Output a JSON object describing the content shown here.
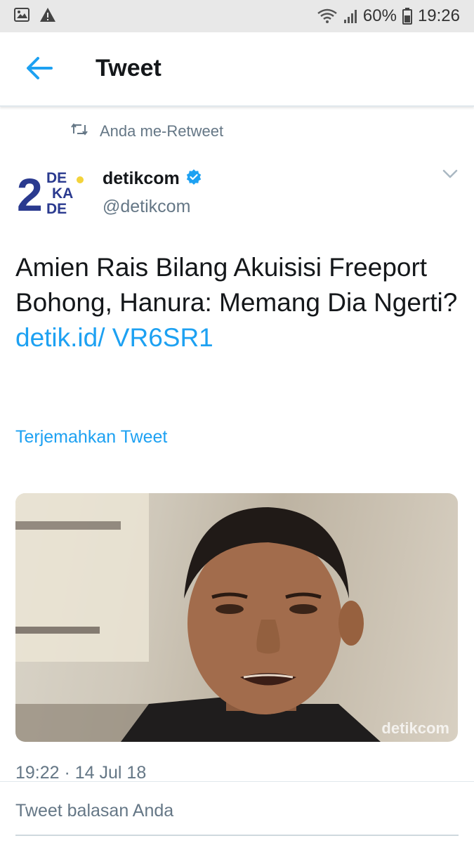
{
  "status_bar": {
    "battery": "60%",
    "time": "19:26",
    "icons": [
      "image-icon",
      "warning-icon",
      "wifi-icon",
      "signal-icon",
      "battery-icon"
    ]
  },
  "app_bar": {
    "title": "Tweet",
    "back_icon": "arrow-left-icon"
  },
  "tweet": {
    "retweet_context": "Anda me-Retweet",
    "avatar_logo": {
      "line1": "DE",
      "line2": "KA",
      "line3": "DE",
      "numeral": "2"
    },
    "display_name": "detikcom",
    "verified": true,
    "handle": "@detikcom",
    "text": "Amien Rais Bilang Akuisisi Freeport Bohong, Hanura: Memang Dia Ngerti?",
    "link_text": "detik.id/ VR6SR1",
    "translate_label": "Terjemahkan Tweet",
    "photo_watermark": "detikcom",
    "timestamp": "19:22 · 14 Jul 18"
  },
  "reply_section": {
    "label": "Tweet balasan Anda"
  },
  "colors": {
    "accent": "#1da1f2",
    "muted_text": "#657786",
    "status_bar_bg": "#e8e8e8",
    "logo_blue": "#2a3a8f",
    "logo_yellow": "#f3d33b"
  }
}
